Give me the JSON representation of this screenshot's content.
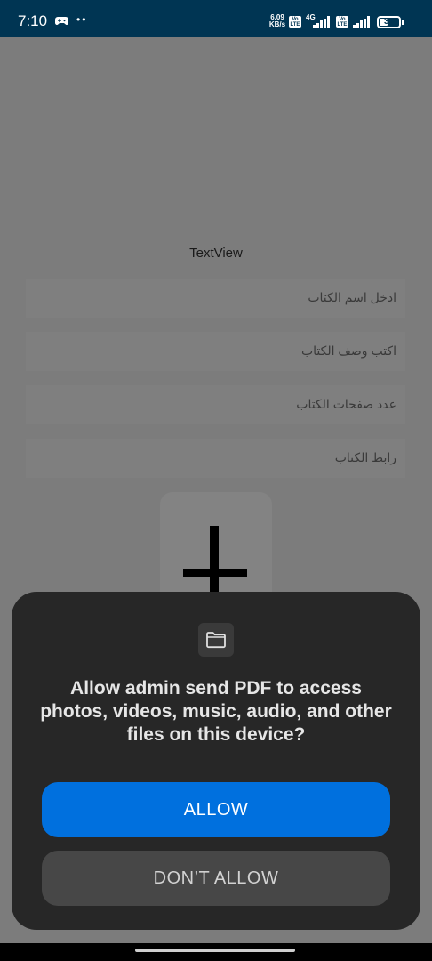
{
  "status_bar": {
    "time": "7:10",
    "dots": "••",
    "speed_value": "6.09",
    "speed_unit": "KB/s",
    "volte_label": "Vo LTE",
    "network_type": "4G",
    "battery": "39",
    "colors": {
      "background": "#003553"
    }
  },
  "form": {
    "textview": "TextView",
    "fields": [
      {
        "placeholder": "ادخل اسم الكتاب"
      },
      {
        "placeholder": "اكتب وصف الكتاب"
      },
      {
        "placeholder": "عدد صفحات الكتاب"
      },
      {
        "placeholder": "رابط الكتاب"
      }
    ],
    "add_button_icon": "plus-icon"
  },
  "dialog": {
    "icon": "folder-icon",
    "message": "Allow admin send PDF to access photos, videos, music, audio, and other files on this device?",
    "allow_label": "ALLOW",
    "deny_label": "DON’T ALLOW",
    "colors": {
      "background": "#272727",
      "allow": "#0070de",
      "deny": "#474747"
    }
  }
}
